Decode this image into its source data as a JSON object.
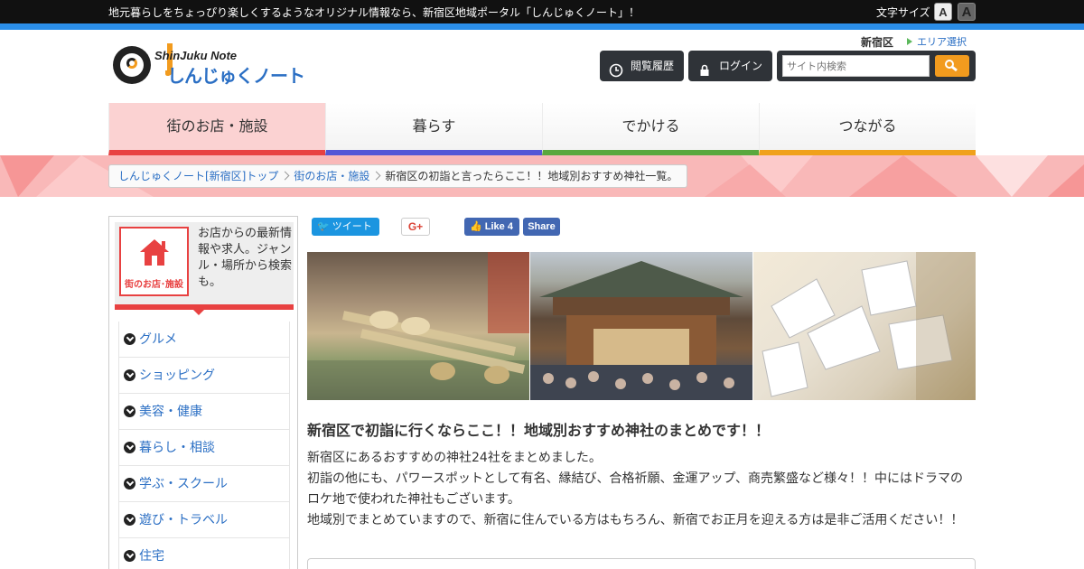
{
  "topbar": {
    "message": "地元暮らしをちょっぴり楽しくするようなオリジナル情報なら、新宿区地域ポータル「しんじゅくノート」！",
    "font_size_label": "文字サイズ",
    "font_small": "A",
    "font_large": "A"
  },
  "logo": {
    "english": "ShinJuku Note",
    "japanese": "しんじゅくノート"
  },
  "header": {
    "area_name": "新宿区",
    "area_select": "エリア選択",
    "history_label": "閲覧履歴",
    "login_label": "ログイン",
    "search_placeholder": "サイト内検索"
  },
  "gnav": {
    "tabs": [
      {
        "label": "街のお店・施設",
        "color": "#e84141"
      },
      {
        "label": "暮らす",
        "color": "#5457d6"
      },
      {
        "label": "でかける",
        "color": "#5aa83e"
      },
      {
        "label": "つながる",
        "color": "#f0a11c"
      }
    ]
  },
  "breadcrumb": {
    "items": [
      "しんじゅくノート[新宿区]トップ",
      "街のお店・施設"
    ],
    "current": "新宿区の初詣と言ったらここ！！地域別おすすめ神社一覧。"
  },
  "sidebar": {
    "category_caption": "街のお店･施設",
    "description": "お店からの最新情報や求人。ジャンル・場所から検索も。",
    "items": [
      {
        "label": "グルメ"
      },
      {
        "label": "ショッピング"
      },
      {
        "label": "美容・健康"
      },
      {
        "label": "暮らし・相談"
      },
      {
        "label": "学ぶ・スクール"
      },
      {
        "label": "遊び・トラベル"
      },
      {
        "label": "住宅"
      }
    ]
  },
  "share": {
    "tweet": "ツイート",
    "gplus": "G+",
    "fb_like": "Like 4",
    "fb_share": "Share"
  },
  "article": {
    "title": "新宿区で初詣に行くならここ！！地域別おすすめ神社のまとめです！！",
    "paragraphs": [
      "新宿区にあるおすすめの神社24社をまとめました。",
      "初詣の他にも、パワースポットとして有名、縁結び、合格祈願、金運アップ、商売繁盛など様々！！中にはドラマの",
      "ロケ地で使われた神社もございます。",
      "地域別でまとめていますので、新宿に住んでいる方はもちろん、新宿でお正月を迎える方は是非ご活用ください！！"
    ]
  }
}
